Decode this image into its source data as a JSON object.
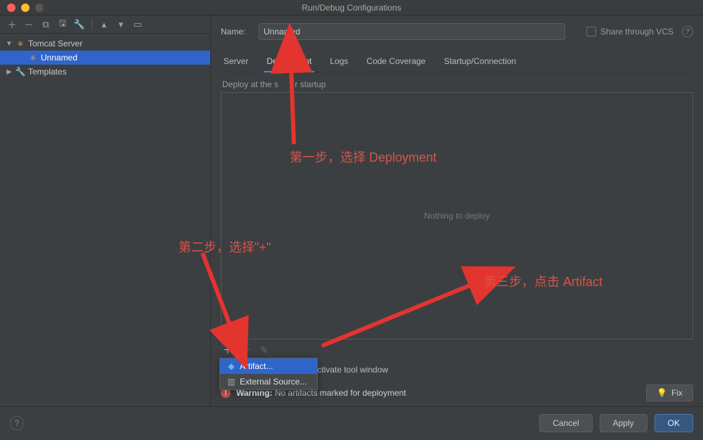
{
  "window": {
    "title": "Run/Debug Configurations"
  },
  "name_field": {
    "label": "Name:",
    "value": "Unnamed"
  },
  "share": {
    "label": "Share through VCS"
  },
  "sidebar": {
    "items": [
      {
        "label": "Tomcat Server"
      },
      {
        "label": "Unnamed"
      },
      {
        "label": "Templates"
      }
    ]
  },
  "tabs": [
    {
      "label": "Server"
    },
    {
      "label": "Deployment"
    },
    {
      "label": "Logs"
    },
    {
      "label": "Code Coverage"
    },
    {
      "label": "Startup/Connection"
    }
  ],
  "deploy": {
    "title_prefix": "Deploy at the s",
    "title_suffix": "r startup",
    "empty": "Nothing to deploy"
  },
  "popup": {
    "artifact": "Artifact...",
    "external": "External Source..."
  },
  "before_launch": "Before launch: Build, Activate tool window",
  "warning": {
    "bold": "Warning:",
    "text": " No artifacts marked for deployment"
  },
  "fix_label": "Fix",
  "buttons": {
    "cancel": "Cancel",
    "apply": "Apply",
    "ok": "OK"
  },
  "annotations": {
    "step1": "第一步，选择 Deployment",
    "step2": "第二步，选择\"+\"",
    "step3": "第三步，点击 Artifact"
  }
}
